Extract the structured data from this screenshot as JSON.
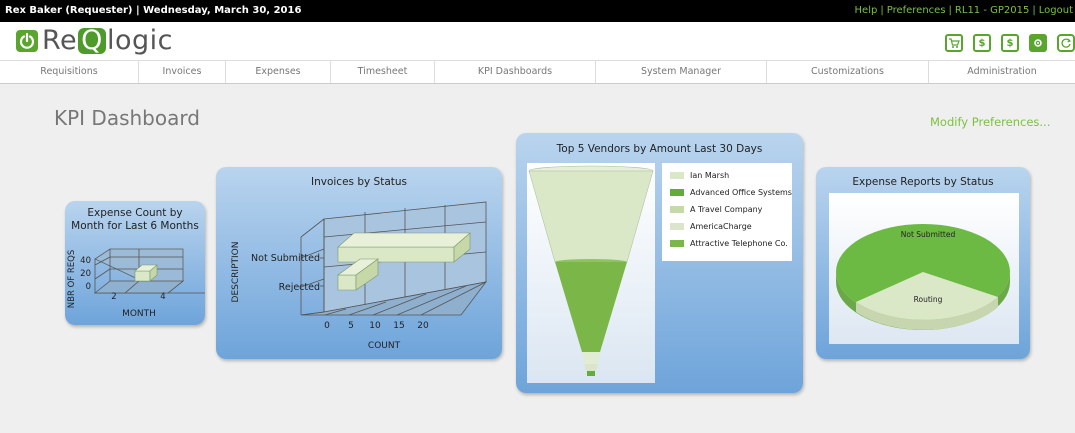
{
  "topbar": {
    "user": "Rex Baker (Requester)",
    "date_sep": " | ",
    "date": "Wednesday, March 30, 2016",
    "links": [
      "Help",
      "Preferences",
      "RL11 - GP2015",
      "Logout"
    ]
  },
  "logo": {
    "part1": "Re",
    "part2": "Q",
    "part3": "logic"
  },
  "toolbar_icons": [
    "cart-icon",
    "dollar-icon",
    "dollar-doc-icon",
    "settings-doc-icon",
    "refresh-icon"
  ],
  "nav": [
    "Requisitions",
    "Invoices",
    "Expenses",
    "Timesheet",
    "KPI Dashboards",
    "System Manager",
    "Customizations",
    "Administration"
  ],
  "page": {
    "title": "KPI Dashboard",
    "modify_link": "Modify Preferences..."
  },
  "panels": {
    "expense_count": {
      "title_line1": "Expense Count by",
      "title_line2": "Month for Last 6 Months",
      "ylabel": "NBR OF REQS",
      "xlabel": "MONTH",
      "yticks": [
        "40",
        "20",
        "0"
      ],
      "xticks": [
        "2",
        "4"
      ]
    },
    "invoices": {
      "title": "Invoices by Status",
      "ylabel": "DESCRIPTION",
      "xlabel": "COUNT",
      "categories": [
        "Not Submitted",
        "Rejected"
      ],
      "xticks": [
        "0",
        "5",
        "10",
        "15",
        "20"
      ]
    },
    "vendors": {
      "title": "Top 5 Vendors by Amount Last 30 Days",
      "legend": [
        "Ian Marsh",
        "Advanced Office Systems",
        "A Travel Company",
        "AmericaCharge",
        "Attractive Telephone Co."
      ]
    },
    "expense_reports": {
      "title": "Expense Reports by Status",
      "labels": [
        "Not Submitted",
        "Routing"
      ]
    }
  },
  "chart_data": [
    {
      "type": "bar",
      "title": "Expense Count by Month for Last 6 Months",
      "xlabel": "MONTH",
      "ylabel": "NBR OF REQS",
      "categories": [
        "3"
      ],
      "values": [
        15
      ],
      "ylim": [
        0,
        40
      ]
    },
    {
      "type": "bar",
      "title": "Invoices by Status",
      "xlabel": "COUNT",
      "ylabel": "DESCRIPTION",
      "categories": [
        "Not Submitted",
        "Rejected"
      ],
      "values": [
        22,
        3
      ],
      "xlim": [
        0,
        20
      ]
    },
    {
      "type": "funnel",
      "title": "Top 5 Vendors by Amount Last 30 Days",
      "categories": [
        "Ian Marsh",
        "Advanced Office Systems",
        "A Travel Company",
        "AmericaCharge",
        "Attractive Telephone Co."
      ],
      "values": [
        37,
        35,
        11,
        11,
        6
      ]
    },
    {
      "type": "pie",
      "title": "Expense Reports by Status",
      "categories": [
        "Not Submitted",
        "Routing"
      ],
      "values": [
        75,
        25
      ]
    }
  ],
  "colors": {
    "accent": "#7cc043",
    "brand": "#5aa52e",
    "light_green": "#dbe8c8",
    "mid_green": "#7ab648",
    "dark_green": "#62ad3a"
  }
}
